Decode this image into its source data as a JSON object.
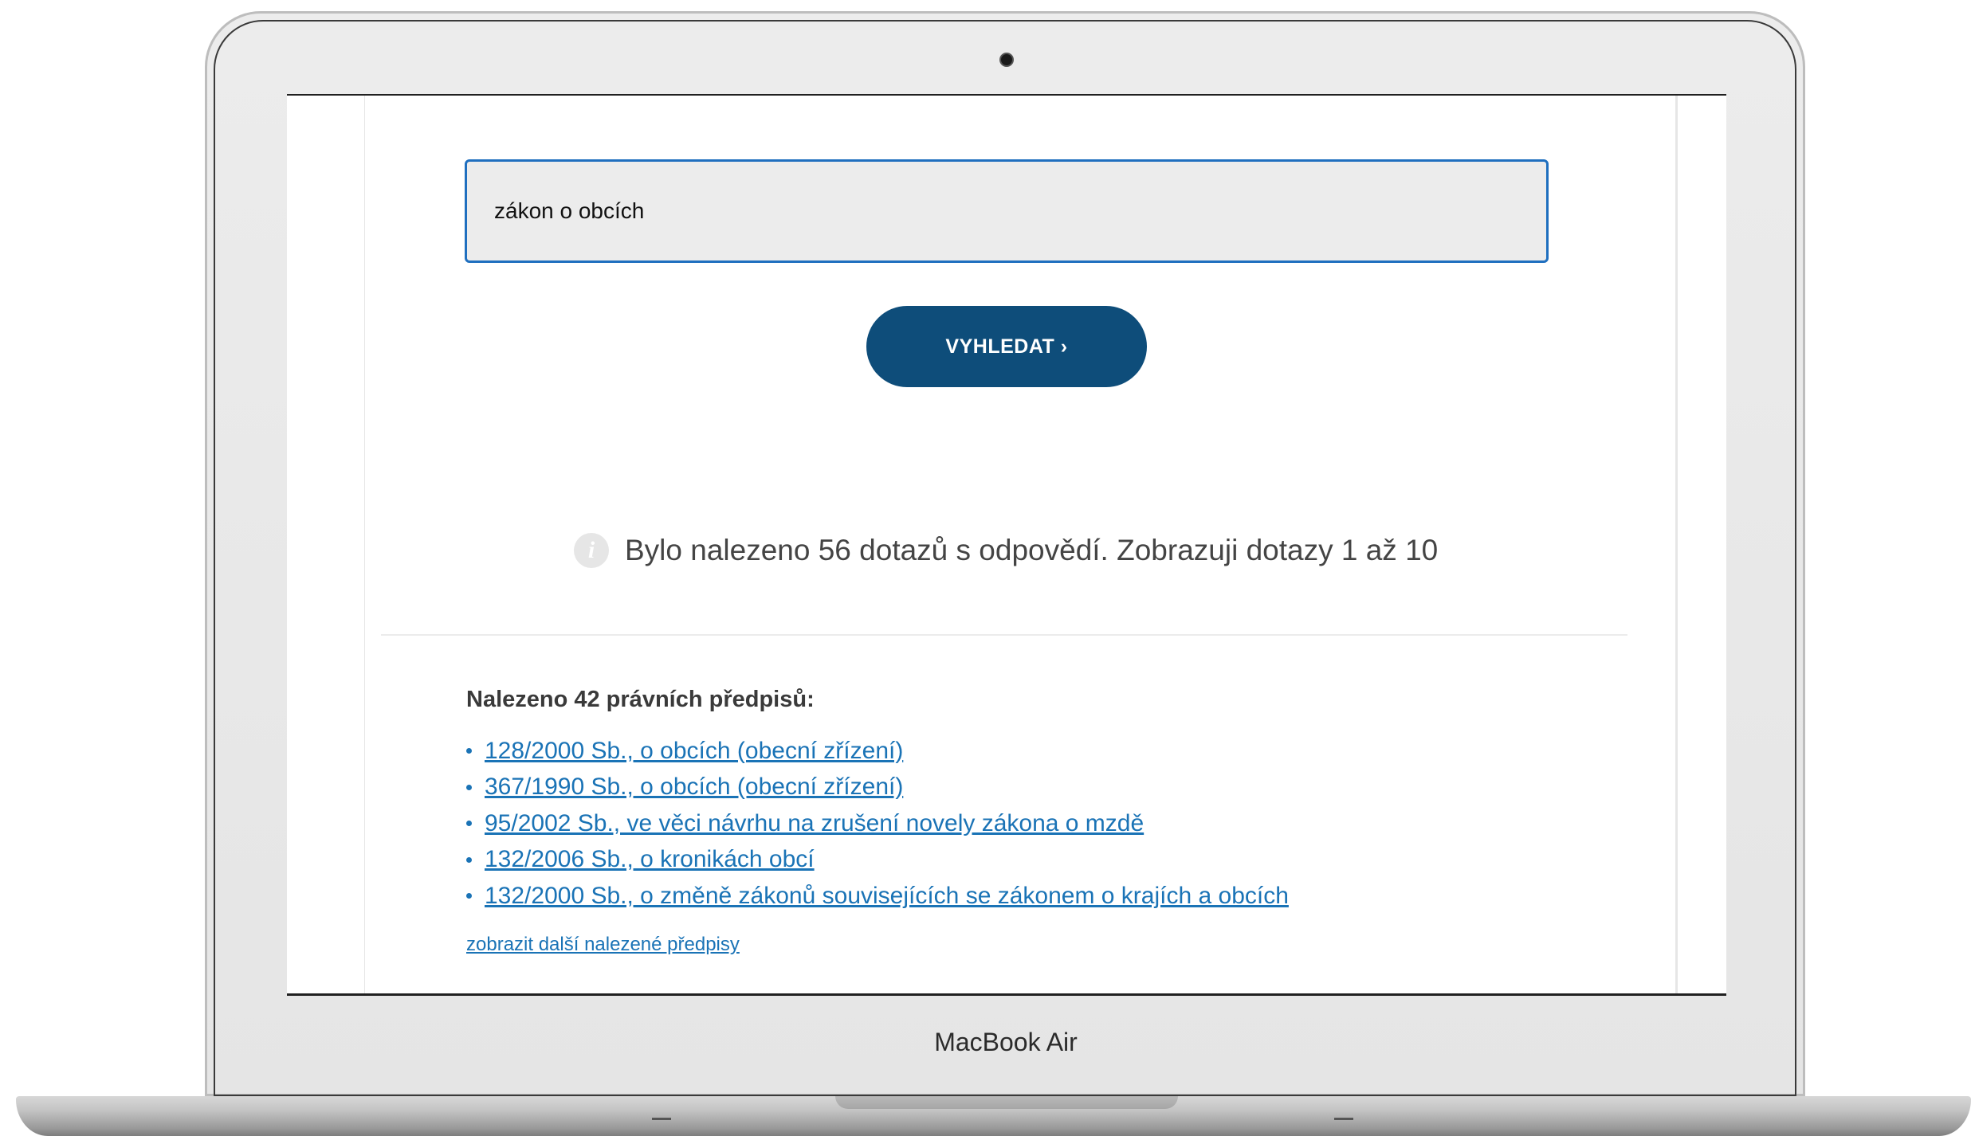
{
  "device": {
    "brand_label": "MacBook Air"
  },
  "search": {
    "query": "zákon o obcích",
    "button_label": "VYHLEDAT ›"
  },
  "info": {
    "icon": "info-icon",
    "icon_glyph": "i",
    "message": "Bylo nalezeno 56 dotazů s odpovědí. Zobrazuji dotazy 1 až 10"
  },
  "regulations": {
    "heading": "Nalezeno 42 právních předpisů:",
    "items": [
      {
        "label": "128/2000 Sb., o obcích (obecní zřízení)"
      },
      {
        "label": "367/1990 Sb., o obcích (obecní zřízení)"
      },
      {
        "label": "95/2002 Sb., ve věci návrhu na zrušení novely zákona o mzdě"
      },
      {
        "label": "132/2006 Sb., o kronikách obcí"
      },
      {
        "label": "132/2000 Sb., o změně zákonů souvisejících se zákonem o krajích a obcích"
      }
    ],
    "more_link": "zobrazit další nalezené předpisy"
  },
  "colors": {
    "button_bg": "#0e4d7a",
    "link": "#1a73b6",
    "input_border": "#1f6fbf"
  }
}
